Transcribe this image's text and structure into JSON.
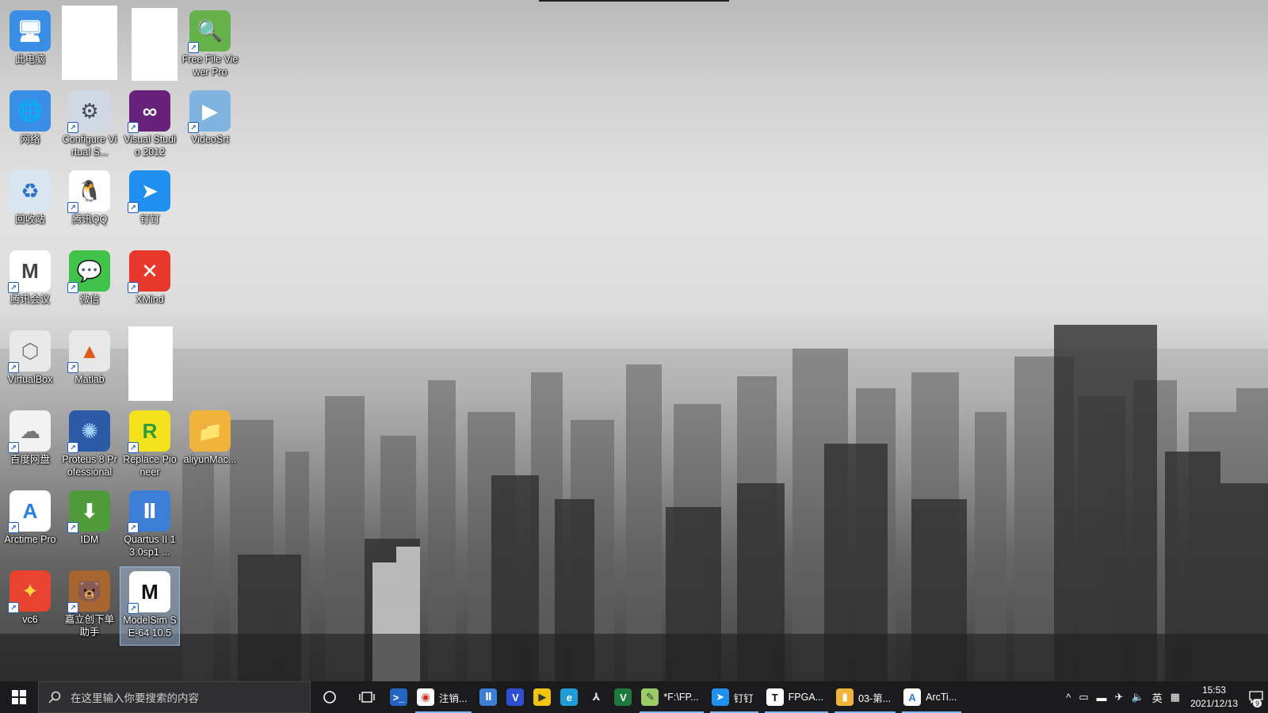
{
  "desktop_icons": [
    {
      "id": "this-pc",
      "label": "此电脑",
      "glyph": "🖥",
      "bg": "#3a8ee6",
      "fg": "#fff",
      "arrow": false
    },
    {
      "id": "network",
      "label": "网络",
      "glyph": "🌐",
      "bg": "#3a8ee6",
      "fg": "#fff",
      "arrow": false
    },
    {
      "id": "recycle-bin",
      "label": "回收站",
      "glyph": "♻",
      "bg": "#d8e6f2",
      "fg": "#2a6fc9",
      "arrow": false
    },
    {
      "id": "tencent-meeting",
      "label": "腾讯会议",
      "glyph": "M",
      "bg": "#ffffff",
      "fg": "#444",
      "arrow": true
    },
    {
      "id": "virtualbox",
      "label": "VirtualBox",
      "glyph": "⬡",
      "bg": "#e9e9e9",
      "fg": "#777",
      "arrow": true
    },
    {
      "id": "baidu-netdisk",
      "label": "百度网盘",
      "glyph": "☁",
      "bg": "#f2f2f2",
      "fg": "#777",
      "arrow": true
    },
    {
      "id": "arctime-pro",
      "label": "Arctime Pro",
      "glyph": "A",
      "bg": "#ffffff",
      "fg": "#2a7de1",
      "arrow": true
    },
    {
      "id": "vc6",
      "label": "vc6",
      "glyph": "✦",
      "bg": "#e8432f",
      "fg": "#ffd33d",
      "arrow": true
    },
    {
      "id": "configure-virtual",
      "label": "Configure Virtual S...",
      "glyph": "⚙",
      "bg": "#cfd8e3",
      "fg": "#445",
      "arrow": true
    },
    {
      "id": "tencent-qq",
      "label": "腾讯QQ",
      "glyph": "🐧",
      "bg": "#ffffff",
      "fg": "#111",
      "arrow": true
    },
    {
      "id": "wechat",
      "label": "微信",
      "glyph": "💬",
      "bg": "#3fc14a",
      "fg": "#fff",
      "arrow": true
    },
    {
      "id": "matlab",
      "label": "Matlab",
      "glyph": "▲",
      "bg": "#e8e8e8",
      "fg": "#e05a1c",
      "arrow": true
    },
    {
      "id": "proteus",
      "label": "Proteus 8 Professional",
      "glyph": "✺",
      "bg": "#2b5aa6",
      "fg": "#9fd3ff",
      "arrow": true
    },
    {
      "id": "idm",
      "label": "IDM",
      "glyph": "⬇",
      "bg": "#4f9a3b",
      "fg": "#fff",
      "arrow": true
    },
    {
      "id": "jlc-helper",
      "label": "嘉立创下单助手",
      "glyph": "🐻",
      "bg": "#a8652f",
      "fg": "#fff",
      "arrow": true
    },
    {
      "id": "visual-studio",
      "label": "Visual Studio 2012",
      "glyph": "∞",
      "bg": "#68217a",
      "fg": "#fff",
      "arrow": true
    },
    {
      "id": "dingtalk",
      "label": "钉钉",
      "glyph": "➤",
      "bg": "#1f8ff0",
      "fg": "#fff",
      "arrow": true
    },
    {
      "id": "xmind",
      "label": "XMind",
      "glyph": "✕",
      "bg": "#e8382b",
      "fg": "#fff",
      "arrow": true
    },
    {
      "id": "replace-pioneer",
      "label": "Replace Pioneer",
      "glyph": "R",
      "bg": "#f4e21c",
      "fg": "#2a9c3a",
      "arrow": true
    },
    {
      "id": "quartus",
      "label": "Quartus II 13.0sp1 ...",
      "glyph": "Ⅱ",
      "bg": "#3d7fd6",
      "fg": "#fff",
      "arrow": true
    },
    {
      "id": "modelsim",
      "label": "ModelSim SE-64 10.5",
      "glyph": "M",
      "bg": "#ffffff",
      "fg": "#111",
      "arrow": true
    },
    {
      "id": "free-file-viewer",
      "label": "Free File Viewer Pro",
      "glyph": "🔍",
      "bg": "#66b24a",
      "fg": "#fff",
      "arrow": true
    },
    {
      "id": "videosrt",
      "label": "VideoSrt",
      "glyph": "▶",
      "bg": "#7fb3e0",
      "fg": "#fff",
      "arrow": true
    },
    {
      "id": "aliyun-mac",
      "label": "aliyunMac...",
      "glyph": "📁",
      "bg": "#f1b43a",
      "fg": "#fff",
      "arrow": false
    }
  ],
  "taskbar": {
    "search_placeholder": "在这里输入你要搜索的内容",
    "apps": [
      {
        "id": "powershell",
        "title": "",
        "glyph": ">_",
        "bg": "#2465c4",
        "fg": "#fff",
        "running": false
      },
      {
        "id": "chrome",
        "title": "注销...",
        "glyph": "◉",
        "bg": "#ffffff",
        "fg": "#d93025",
        "running": true
      },
      {
        "id": "quartus-task",
        "title": "",
        "glyph": "Ⅱ",
        "bg": "#3d7fd6",
        "fg": "#fff",
        "running": false
      },
      {
        "id": "vivado",
        "title": "",
        "glyph": "V",
        "bg": "#2d4fd1",
        "fg": "#fff",
        "running": false
      },
      {
        "id": "potplayer",
        "title": "",
        "glyph": "▶",
        "bg": "#f1c40f",
        "fg": "#333",
        "running": false
      },
      {
        "id": "edge",
        "title": "",
        "glyph": "e",
        "bg": "#1f9dd9",
        "fg": "#fff",
        "running": false
      },
      {
        "id": "acrobat",
        "title": "",
        "glyph": "⅄",
        "bg": "#1b1b1d",
        "fg": "#ddd",
        "running": false
      },
      {
        "id": "excel-v",
        "title": "",
        "glyph": "V",
        "bg": "#1e7a3c",
        "fg": "#fff",
        "running": false
      },
      {
        "id": "notepad-pp",
        "title": "*F:\\FP...",
        "glyph": "✎",
        "bg": "#9ccc65",
        "fg": "#333",
        "running": true
      },
      {
        "id": "dingtalk-task",
        "title": "钉钉",
        "glyph": "➤",
        "bg": "#1f8ff0",
        "fg": "#fff",
        "running": true
      },
      {
        "id": "typora",
        "title": "FPGA...",
        "glyph": "T",
        "bg": "#ffffff",
        "fg": "#111",
        "running": true
      },
      {
        "id": "explorer",
        "title": "03-第...",
        "glyph": "▮",
        "bg": "#f1b43a",
        "fg": "#fff",
        "running": true
      },
      {
        "id": "arctime-task",
        "title": "ArcTi...",
        "glyph": "A",
        "bg": "#ffffff",
        "fg": "#2a7de1",
        "running": true
      }
    ],
    "tray": {
      "chevron": "^",
      "icons": [
        "▭",
        "▬",
        "✈",
        "🔈"
      ],
      "ime": "英",
      "ime_grid": "▦",
      "time": "15:53",
      "date": "2021/12/13",
      "notification_count": "9"
    }
  }
}
